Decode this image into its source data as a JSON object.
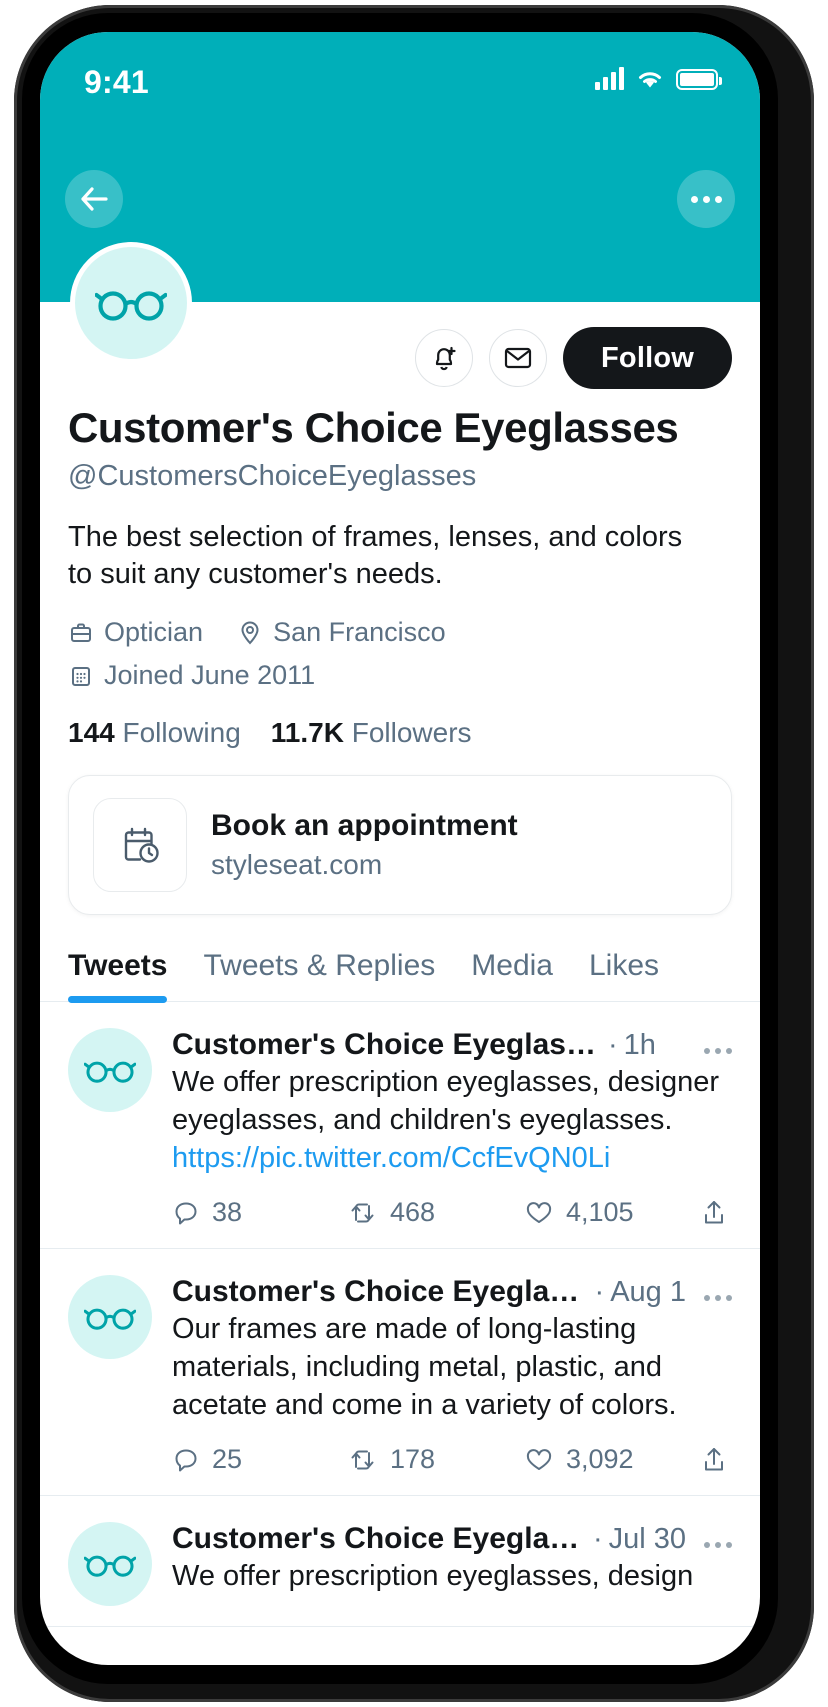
{
  "status_bar": {
    "time": "9:41",
    "cellular_icon": "signal-bars-icon",
    "wifi_icon": "wifi-icon",
    "battery_icon": "battery-full-icon"
  },
  "header": {
    "banner_color": "#00AFB9",
    "back_icon": "back-arrow-icon",
    "more_icon": "more-options-icon"
  },
  "profile": {
    "avatar_icon": "eyeglasses-icon",
    "avatar_bg": "#D4F5F3",
    "avatar_fg": "#00A3A8",
    "notify_icon": "bell-plus-icon",
    "message_icon": "envelope-icon",
    "follow_label": "Follow",
    "display_name": "Customer's Choice Eyeglasses",
    "handle": "@CustomersChoiceEyeglasses",
    "bio": "The best selection of frames, lenses, and colors to suit any customer's needs.",
    "category_icon": "briefcase-icon",
    "category": "Optician",
    "location_icon": "location-pin-icon",
    "location": "San Francisco",
    "joined_icon": "calendar-icon",
    "joined": "Joined June 2011",
    "following_count": "144",
    "following_label": "Following",
    "followers_count": "11.7K",
    "followers_label": "Followers"
  },
  "appointment_card": {
    "icon": "calendar-clock-icon",
    "title": "Book an appointment",
    "subtitle": "styleseat.com"
  },
  "tabs": [
    {
      "label": "Tweets",
      "active": true
    },
    {
      "label": "Tweets & Replies",
      "active": false
    },
    {
      "label": "Media",
      "active": false
    },
    {
      "label": "Likes",
      "active": false
    }
  ],
  "accent_colors": {
    "brand_teal": "#00AFB9",
    "link_blue": "#1D9BF0",
    "text_primary": "#14171A",
    "text_secondary": "#5B7083",
    "divider": "#E6ECF0"
  },
  "tweets": [
    {
      "name": "Customer's Choice Eyeglasses",
      "name_truncated": true,
      "separator": "·",
      "time": "1h",
      "text": "We offer prescription eyeglasses, designer eyeglasses, and children's eyeglasses. ",
      "link": "https://pic.twitter.com/CcfEvQN0Li",
      "reply_icon": "comment-icon",
      "replies": "38",
      "retweet_icon": "retweet-icon",
      "retweets": "468",
      "like_icon": "heart-icon",
      "likes": "4,105",
      "share_icon": "share-icon",
      "more_icon": "tweet-more-icon"
    },
    {
      "name": "Customer's Choice Eyeglasses",
      "name_truncated": false,
      "separator": "·",
      "time": "Aug 1",
      "text": "Our frames are made of long-lasting materials, including metal, plastic, and acetate and come in a variety of colors.",
      "link": "",
      "reply_icon": "comment-icon",
      "replies": "25",
      "retweet_icon": "retweet-icon",
      "retweets": "178",
      "like_icon": "heart-icon",
      "likes": "3,092",
      "share_icon": "share-icon",
      "more_icon": "tweet-more-icon"
    },
    {
      "name": "Customer's Choice Eyeglasses",
      "name_truncated": false,
      "separator": "·",
      "time": "Jul 30",
      "text": "We offer prescription eyeglasses, design",
      "link": "",
      "reply_icon": "comment-icon",
      "replies": "",
      "retweet_icon": "retweet-icon",
      "retweets": "",
      "like_icon": "heart-icon",
      "likes": "",
      "share_icon": "share-icon",
      "more_icon": "tweet-more-icon"
    }
  ]
}
